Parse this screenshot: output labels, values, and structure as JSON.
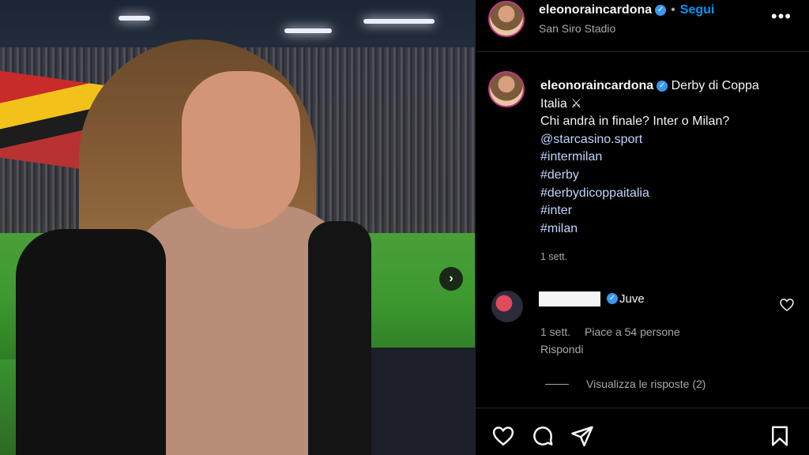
{
  "post": {
    "username": "eleonoraincardona",
    "follow_label": "Segui",
    "location": "San Siro Stadio",
    "more_label": "•••",
    "next_label": "›"
  },
  "caption": {
    "username": "eleonoraincardona",
    "lines": [
      "Derby di Coppa",
      "Italia ⚔",
      "Chi andrà in finale? Inter o Milan?"
    ],
    "tags": [
      "@starcasino.sport",
      "#intermilan",
      "#derby",
      "#derbydicoppaitalia",
      "#inter",
      "#milan"
    ],
    "time": "1 sett."
  },
  "comment": {
    "text": "Juve",
    "time": "1 sett.",
    "likes": "Piace a 54 persone",
    "reply": "Rispondi",
    "view_replies": "Visualizza le risposte (2)"
  },
  "colors": {
    "accent_blue": "#0095f6",
    "verified_blue": "#3897f0",
    "hashtag": "#c0d5ff",
    "background": "#000000"
  },
  "icons": {
    "like": "heart-icon",
    "comment": "comment-icon",
    "share": "send-icon",
    "save": "bookmark-icon"
  }
}
